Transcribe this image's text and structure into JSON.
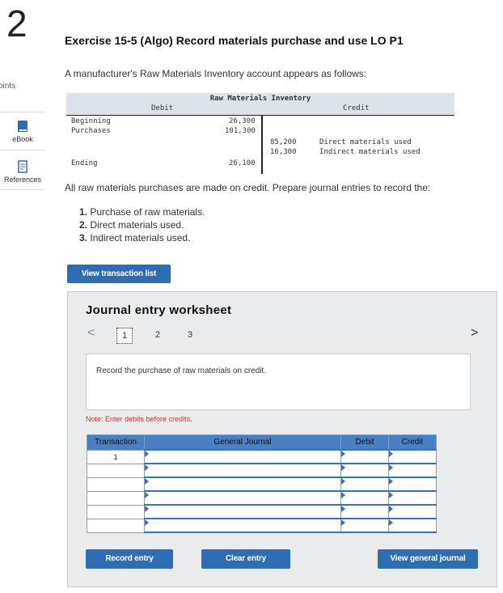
{
  "question_number": "2",
  "points_label": "oints",
  "sidebar": {
    "ebook": "eBook",
    "references": "References"
  },
  "title": "Exercise 15-5 (Algo) Record materials purchase and use LO P1",
  "intro": "A manufacturer's Raw Materials Inventory account appears as follows:",
  "t_account": {
    "title": "Raw Materials Inventory",
    "debit_header": "Debit",
    "credit_header": "Credit",
    "debit_rows": [
      {
        "label": "Beginning",
        "amount": "26,300"
      },
      {
        "label": "Purchases",
        "amount": "101,300"
      }
    ],
    "credit_rows": [
      {
        "amount": "85,200",
        "label": "Direct materials used"
      },
      {
        "amount": "16,300",
        "label": "Indirect materials used"
      }
    ],
    "ending": {
      "label": "Ending",
      "amount": "26,100"
    }
  },
  "instruction": "All raw materials purchases are made on credit. Prepare journal entries to record the:",
  "steps": [
    {
      "num": "1.",
      "text": "Purchase of raw materials."
    },
    {
      "num": "2.",
      "text": "Direct materials used."
    },
    {
      "num": "3.",
      "text": "Indirect materials used."
    }
  ],
  "view_transaction_list": "View transaction list",
  "worksheet": {
    "title": "Journal entry worksheet",
    "prev": "<",
    "next": ">",
    "pages": [
      "1",
      "2",
      "3"
    ],
    "prompt": "Record the purchase of raw materials on credit.",
    "note": "Note: Enter debits before credits.",
    "columns": [
      "Transaction",
      "General Journal",
      "Debit",
      "Credit"
    ],
    "transaction_value": "1",
    "record_entry": "Record entry",
    "clear_entry": "Clear entry",
    "view_general_journal": "View general journal"
  },
  "colors": {
    "accent": "#2e6db4",
    "table_header": "#4a7fc4",
    "note": "#c0392b"
  }
}
